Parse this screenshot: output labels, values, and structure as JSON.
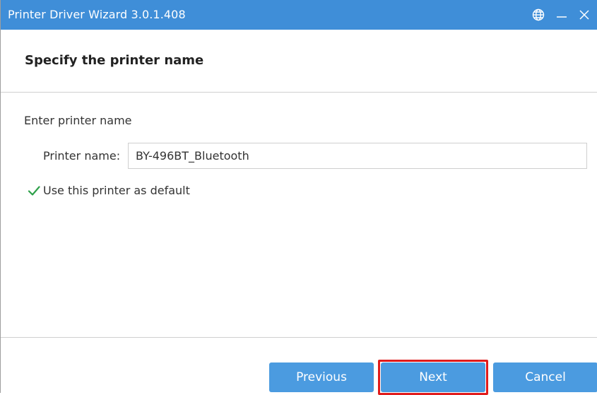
{
  "window": {
    "title": "Printer Driver Wizard  3.0.1.408",
    "controls": {
      "globe_icon": "globe-icon",
      "minimize_icon": "minimize-icon",
      "close_icon": "close-icon"
    },
    "titlebar_color": "#3f8ed8"
  },
  "header": {
    "title": "Specify the printer name"
  },
  "form": {
    "section_label": "Enter printer name",
    "printer_name_label": "Printer name:",
    "printer_name_value": "BY-496BT_Bluetooth",
    "default_checkbox": {
      "label": "Use this printer as default",
      "checked": true
    }
  },
  "buttons": {
    "previous": "Previous",
    "next": "Next",
    "cancel": "Cancel",
    "color": "#4b9be0",
    "highlight_color": "#e01b1b"
  }
}
